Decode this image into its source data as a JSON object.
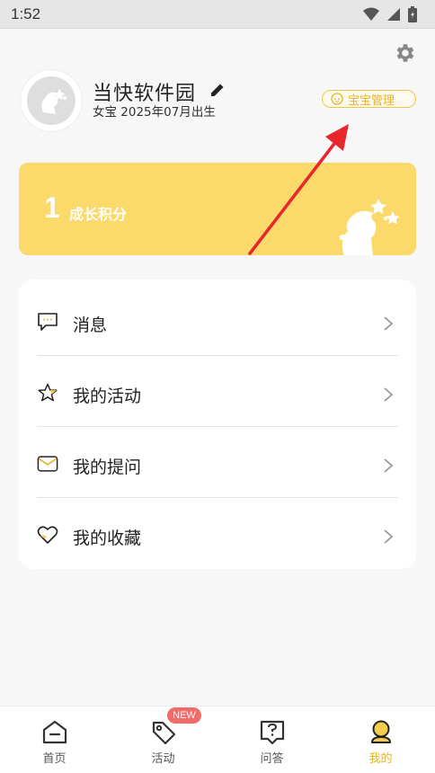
{
  "status_bar": {
    "time": "1:52"
  },
  "profile": {
    "name": "当快软件园",
    "subtitle": "女宝 2025年07月出生",
    "baby_manage_label": "宝宝管理"
  },
  "points": {
    "value": "1",
    "label": "成长积分"
  },
  "menu": {
    "items": [
      {
        "label": "消息",
        "icon": "message-icon"
      },
      {
        "label": "我的活动",
        "icon": "star-icon"
      },
      {
        "label": "我的提问",
        "icon": "envelope-icon"
      },
      {
        "label": "我的收藏",
        "icon": "heart-icon"
      }
    ]
  },
  "bottom_nav": {
    "items": [
      {
        "label": "首页",
        "icon": "home-icon"
      },
      {
        "label": "活动",
        "icon": "tag-icon"
      },
      {
        "label": "问答",
        "icon": "question-icon"
      },
      {
        "label": "我的",
        "icon": "profile-icon"
      }
    ],
    "active_index": 3,
    "new_badge": "NEW"
  },
  "colors": {
    "accent": "#fbd96a",
    "accent_text": "#e8b32a",
    "badge": "#f26b6b",
    "arrow": "#e8262b"
  }
}
